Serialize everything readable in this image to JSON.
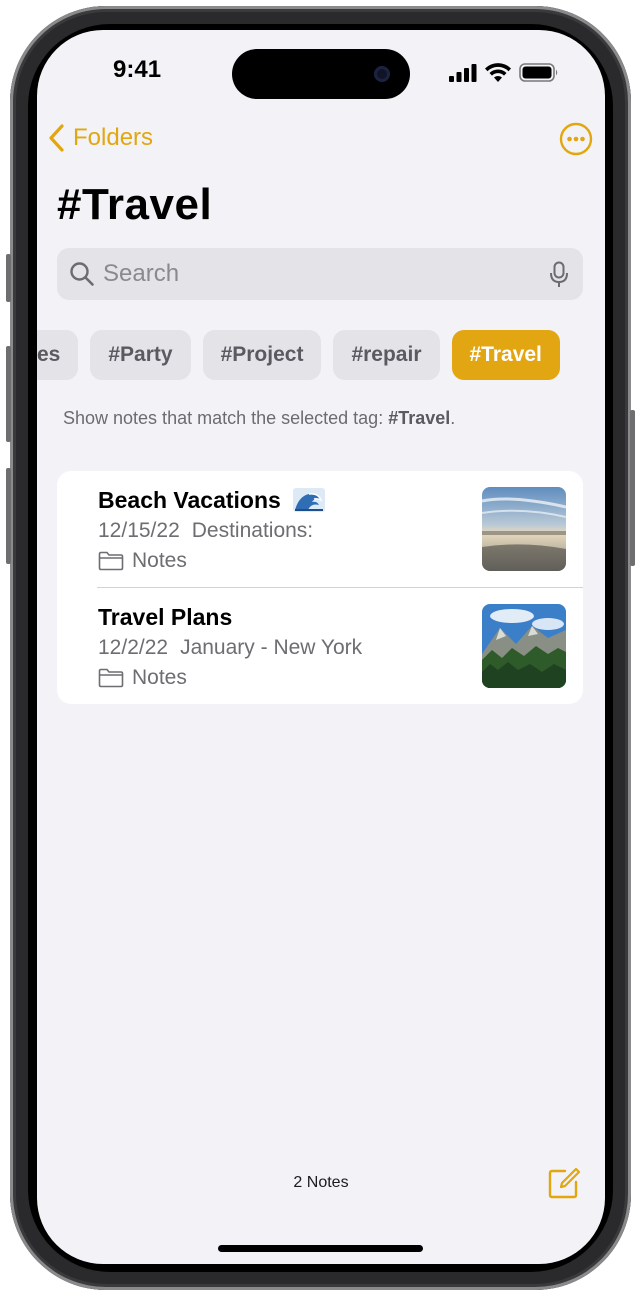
{
  "status_bar": {
    "time": "9:41"
  },
  "nav": {
    "back_label": "Folders"
  },
  "page": {
    "title": "#Travel"
  },
  "search": {
    "placeholder": "Search"
  },
  "tags": [
    {
      "label": "es",
      "selected": false
    },
    {
      "label": "#Party",
      "selected": false
    },
    {
      "label": "#Project",
      "selected": false
    },
    {
      "label": "#repair",
      "selected": false
    },
    {
      "label": "#Travel",
      "selected": true
    }
  ],
  "hint": {
    "text": "Show notes that match the selected tag: ",
    "tag": "#Travel",
    "end": "."
  },
  "notes": [
    {
      "title": "Beach Vacations",
      "emoji": "wave-icon",
      "date": "12/15/22",
      "preview": "Destinations:",
      "folder": "Notes",
      "thumbnail": "beach-photo"
    },
    {
      "title": "Travel Plans",
      "date": "12/2/22",
      "preview": "January - New York",
      "folder": "Notes",
      "thumbnail": "mountain-forest-photo"
    }
  ],
  "footer": {
    "count": "2 Notes"
  },
  "colors": {
    "accent": "#E3A613",
    "background": "#F2F2F7",
    "secondary_text": "#6D6D72"
  }
}
